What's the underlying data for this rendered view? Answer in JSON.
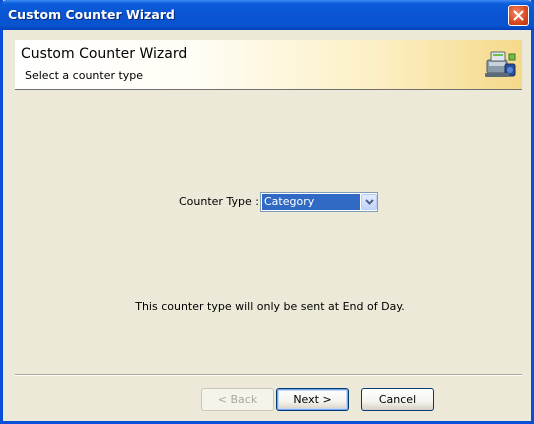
{
  "window": {
    "title": "Custom Counter Wizard",
    "close_icon": "close-icon"
  },
  "header": {
    "title": "Custom Counter Wizard",
    "subtitle": "Select a counter type",
    "icon": "wizard-machine-icon"
  },
  "form": {
    "counter_type_label": "Counter Type :",
    "counter_type_value": "Category",
    "dropdown_icon": "chevron-down-icon"
  },
  "info": {
    "text": "This counter type will only be sent at End of Day."
  },
  "buttons": {
    "back": {
      "label": "< Back",
      "enabled": false
    },
    "next": {
      "label": "Next >",
      "enabled": true,
      "default": true
    },
    "cancel": {
      "label": "Cancel",
      "enabled": true
    }
  },
  "colors": {
    "titlebar": "#0a54d2",
    "dialog_bg": "#ece9d8",
    "selection": "#316ac5",
    "close_button": "#d84820"
  }
}
